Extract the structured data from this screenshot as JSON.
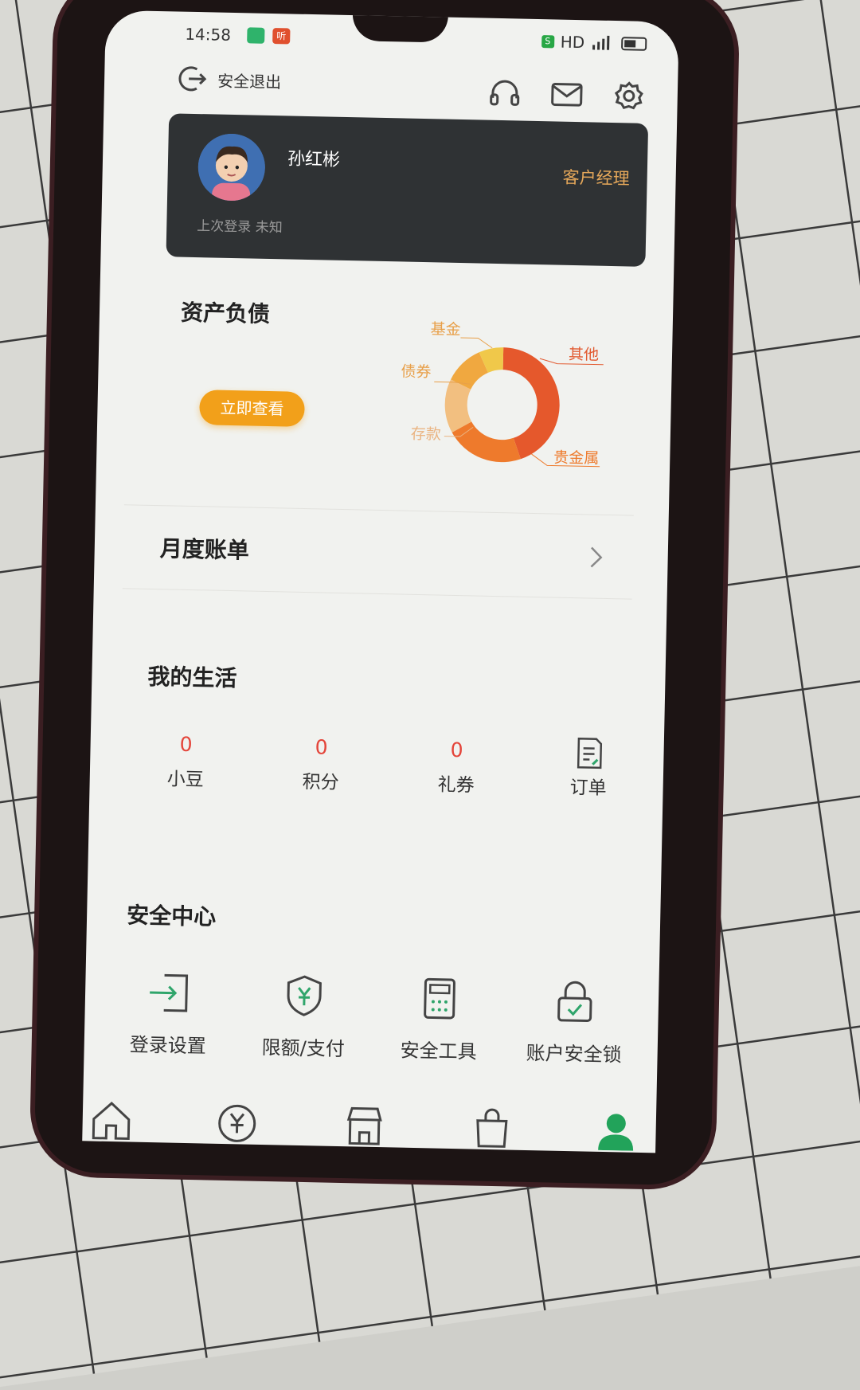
{
  "status_bar": {
    "time": "14:58",
    "network": "HD"
  },
  "header": {
    "logout_label": "安全退出"
  },
  "profile": {
    "name": "孙红彬",
    "manager_label": "客户经理",
    "last_login": "上次登录 未知"
  },
  "assets": {
    "title": "资产负债",
    "button_label": "立即查看",
    "chart_data": {
      "type": "pie",
      "legend": [
        "基金",
        "其他",
        "债券",
        "存款",
        "贵金属"
      ],
      "colors": {
        "基金": "#f0c84a",
        "其他": "#e5582c",
        "债券": "#f0a840",
        "存款": "#f2bf80",
        "贵金属": "#ee7a2c"
      }
    }
  },
  "bill": {
    "title": "月度账单"
  },
  "life": {
    "title": "我的生活",
    "items": [
      {
        "value": "0",
        "label": "小豆"
      },
      {
        "value": "0",
        "label": "积分"
      },
      {
        "value": "0",
        "label": "礼券"
      },
      {
        "label": "订单"
      }
    ]
  },
  "security": {
    "title": "安全中心",
    "items": [
      {
        "label": "登录设置"
      },
      {
        "label": "限额/支付"
      },
      {
        "label": "安全工具"
      },
      {
        "label": "账户安全锁"
      }
    ]
  }
}
